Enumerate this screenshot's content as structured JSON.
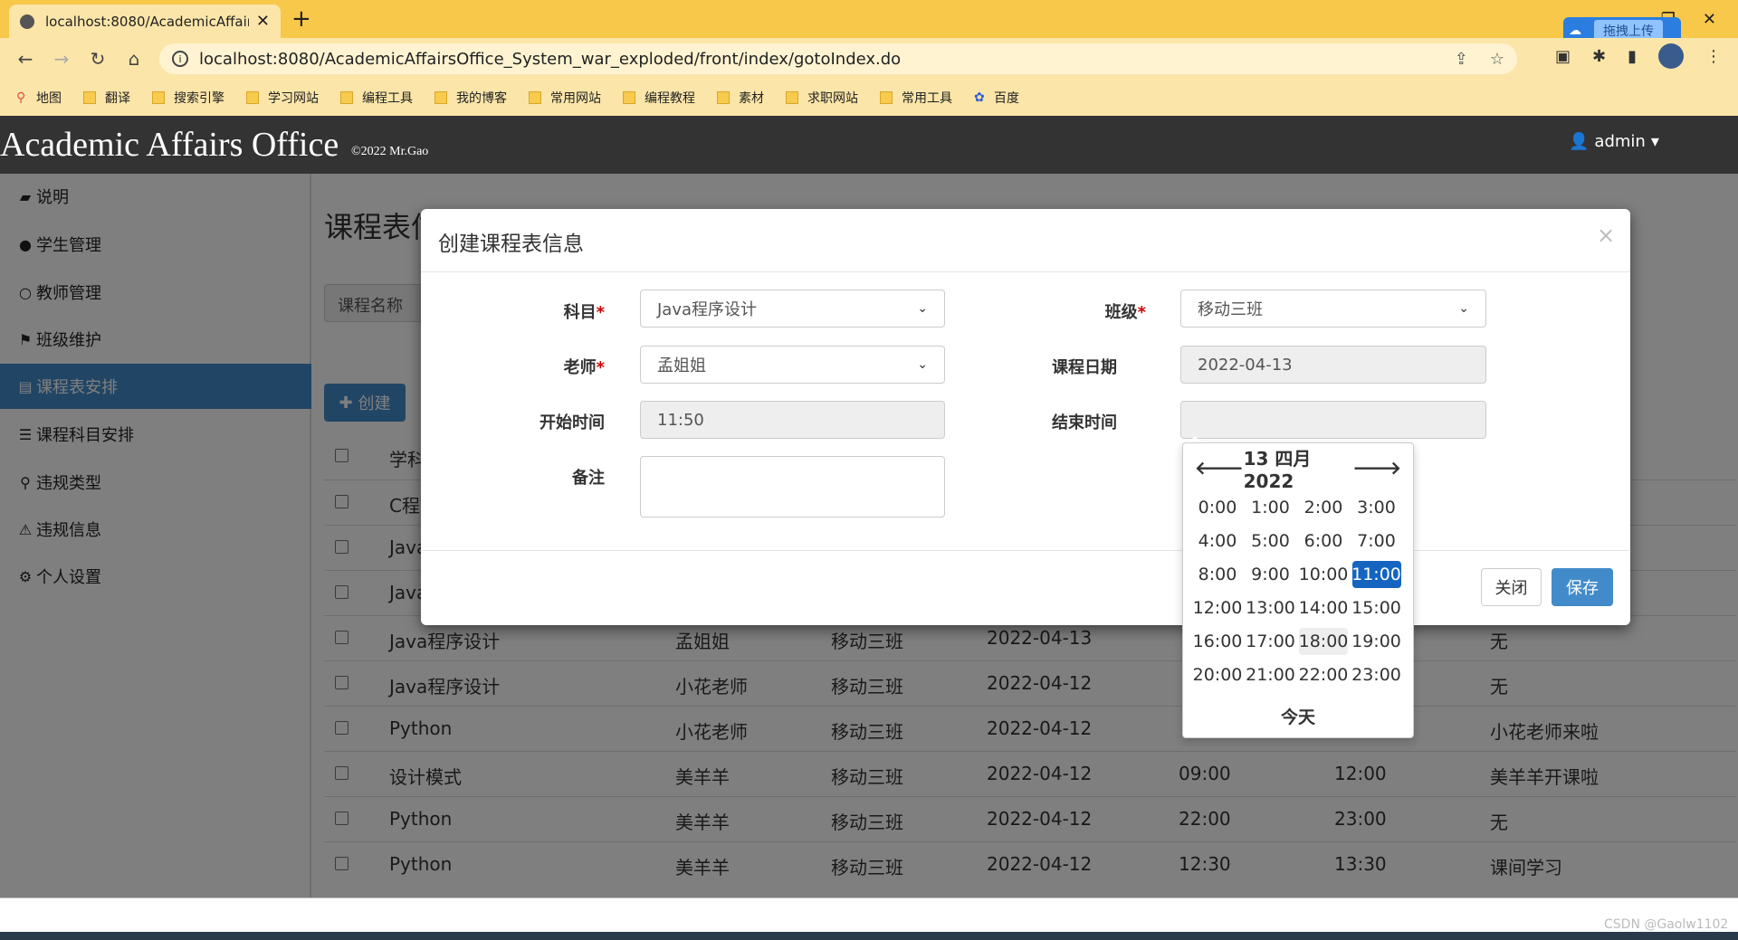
{
  "browser": {
    "tab_title": "localhost:8080/AcademicAffair",
    "url": "localhost:8080/AcademicAffairsOffice_System_war_exploded/front/index/gotoIndex.do",
    "cloud_upload_label": "拖拽上传",
    "bookmarks": [
      "地图",
      "翻译",
      "搜索引擎",
      "学习网站",
      "编程工具",
      "我的博客",
      "常用网站",
      "编程教程",
      "素材",
      "求职网站",
      "常用工具",
      "百度"
    ]
  },
  "app": {
    "brand": "Academic Affairs Office",
    "copyright": "©2022 Mr.Gao",
    "user": "admin"
  },
  "sidebar": {
    "items": [
      {
        "label": "说明",
        "icon": "comment-icon"
      },
      {
        "label": "学生管理",
        "icon": "user-icon"
      },
      {
        "label": "教师管理",
        "icon": "circle-icon"
      },
      {
        "label": "班级维护",
        "icon": "flag-icon"
      },
      {
        "label": "课程表安排",
        "icon": "book-icon",
        "active": true
      },
      {
        "label": "课程科目安排",
        "icon": "list-icon"
      },
      {
        "label": "违规类型",
        "icon": "search-icon"
      },
      {
        "label": "违规信息",
        "icon": "warning-icon"
      },
      {
        "label": "个人设置",
        "icon": "gear-icon"
      }
    ]
  },
  "main": {
    "page_title": "课程表信",
    "search_placeholder": "课程名称",
    "create_label": "创建",
    "table_header_first": "学科",
    "rows": [
      {
        "subject": "C程",
        "teacher": "",
        "class": "",
        "date": "",
        "start": "",
        "end": "",
        "remark": ""
      },
      {
        "subject": "Java",
        "teacher": "",
        "class": "",
        "date": "",
        "start": "",
        "end": "",
        "remark": ""
      },
      {
        "subject": "Java",
        "teacher": "",
        "class": "",
        "date": "",
        "start": "",
        "end": "",
        "remark": ""
      },
      {
        "subject": "Java程序设计",
        "teacher": "孟姐姐",
        "class": "移动三班",
        "date": "2022-04-13",
        "start": "",
        "end": "",
        "remark": "无"
      },
      {
        "subject": "Java程序设计",
        "teacher": "小花老师",
        "class": "移动三班",
        "date": "2022-04-12",
        "start": "",
        "end": "",
        "remark": "无"
      },
      {
        "subject": "Python",
        "teacher": "小花老师",
        "class": "移动三班",
        "date": "2022-04-12",
        "start": "",
        "end": "",
        "remark": "小花老师来啦"
      },
      {
        "subject": "设计模式",
        "teacher": "美羊羊",
        "class": "移动三班",
        "date": "2022-04-12",
        "start": "09:00",
        "end": "12:00",
        "remark": "美羊羊开课啦"
      },
      {
        "subject": "Python",
        "teacher": "美羊羊",
        "class": "移动三班",
        "date": "2022-04-12",
        "start": "22:00",
        "end": "23:00",
        "remark": "无"
      },
      {
        "subject": "Python",
        "teacher": "美羊羊",
        "class": "移动三班",
        "date": "2022-04-12",
        "start": "12:30",
        "end": "13:30",
        "remark": "课间学习"
      }
    ]
  },
  "modal": {
    "title": "创建课程表信息",
    "fields": {
      "subject_label": "科目",
      "subject_value": "Java程序设计",
      "class_label": "班级",
      "class_value": "移动三班",
      "teacher_label": "老师",
      "teacher_value": "孟姐姐",
      "date_label": "课程日期",
      "date_value": "2022-04-13",
      "start_label": "开始时间",
      "start_value": "11:50",
      "end_label": "结束时间",
      "end_value": "",
      "remark_label": "备注"
    },
    "close_label": "关闭",
    "save_label": "保存"
  },
  "picker": {
    "title": "13 四月 2022",
    "hours": [
      "0:00",
      "1:00",
      "2:00",
      "3:00",
      "4:00",
      "5:00",
      "6:00",
      "7:00",
      "8:00",
      "9:00",
      "10:00",
      "11:00",
      "12:00",
      "13:00",
      "14:00",
      "15:00",
      "16:00",
      "17:00",
      "18:00",
      "19:00",
      "20:00",
      "21:00",
      "22:00",
      "23:00"
    ],
    "selected": "11:00",
    "hovered": "18:00",
    "today_label": "今天"
  },
  "footer": {
    "watermark": "CSDN @Gaolw1102"
  }
}
